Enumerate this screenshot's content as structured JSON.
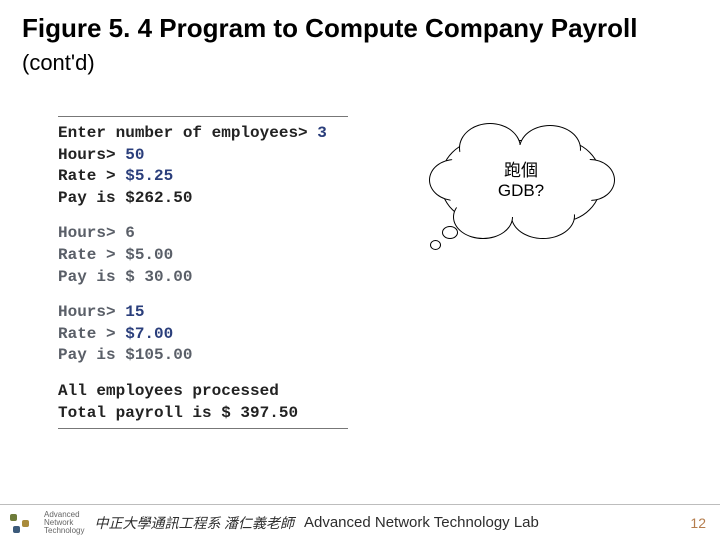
{
  "title": {
    "main": "Figure 5. 4  Program to Compute Company Payroll ",
    "contd": "(cont'd)"
  },
  "program": {
    "block1": {
      "l1a": "Enter number of employees> ",
      "l1b": "3",
      "l2a": "Hours> ",
      "l2b": "50",
      "l3a": "Rate > ",
      "l3b": "$5.25",
      "l4": "Pay is $262.50"
    },
    "block2": {
      "l1": "Hours> 6",
      "l2": "Rate > $5.00",
      "l3": "Pay is $ 30.00"
    },
    "block3": {
      "l1a": "Hours> ",
      "l1b": "15",
      "l2a": "Rate > ",
      "l2b": "$7.00",
      "l3": "Pay is $105.00"
    },
    "block4": {
      "l1": "All employees processed",
      "l2": "Total payroll is $  397.50"
    }
  },
  "thought": {
    "line1": "跑個",
    "line2": "GDB?"
  },
  "footer": {
    "logo_text": "Advanced\nNetwork\nTechnology",
    "cn": "中正大學通訊工程系 潘仁義老師",
    "en": "Advanced Network Technology Lab",
    "page": "12"
  }
}
